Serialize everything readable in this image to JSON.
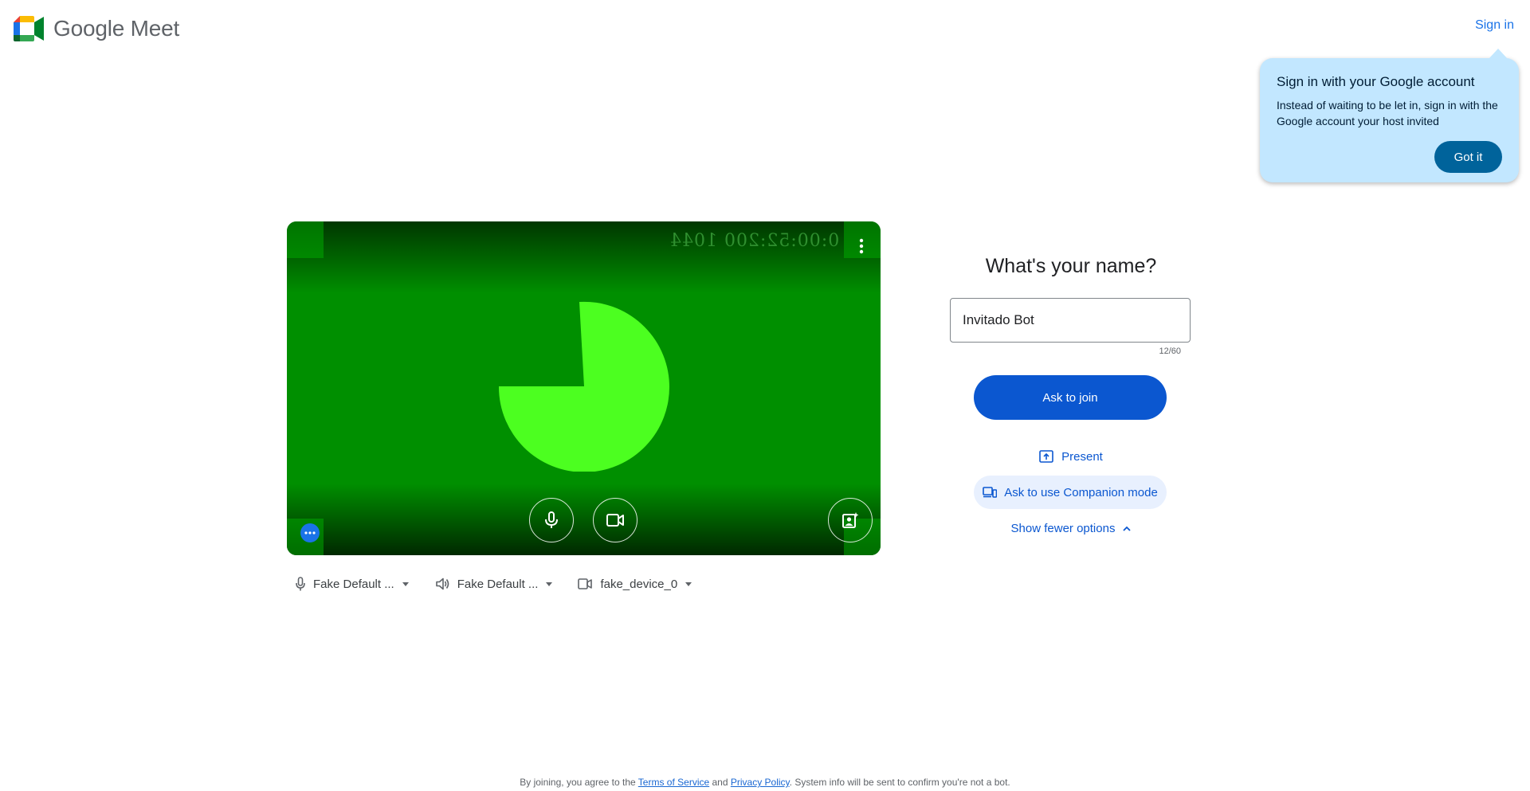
{
  "header": {
    "brand_text": "Google Meet",
    "signin_label": "Sign in"
  },
  "callout": {
    "title": "Sign in with your Google account",
    "body": "Instead of waiting to be let in, sign in with the Google account your host invited",
    "button_label": "Got it",
    "background_color": "#c2e7ff"
  },
  "preview": {
    "timestamp": "0:00:52:200 1044",
    "background_color": "#008f00",
    "pie_color": "#4cff20",
    "icons": [
      "more-vert-icon",
      "mic-icon",
      "camera-icon",
      "visual-effects-icon",
      "more-horiz-icon"
    ]
  },
  "devices": {
    "microphone_label": "Fake Default ...",
    "speaker_label": "Fake Default ...",
    "camera_label": "fake_device_0"
  },
  "join": {
    "title": "What's your name?",
    "name_value": "Invitado Bot",
    "char_count": "12/60",
    "ask_join_label": "Ask to join",
    "present_label": "Present",
    "companion_label": "Ask to use Companion mode",
    "fewer_options_label": "Show fewer options",
    "accent_color": "#0b57d0"
  },
  "footer": {
    "prefix": "By joining, you agree to the ",
    "terms_label": "Terms of Service",
    "and_text": " and ",
    "privacy_label": "Privacy Policy",
    "suffix": ". System info will be sent to confirm you're not a bot."
  }
}
